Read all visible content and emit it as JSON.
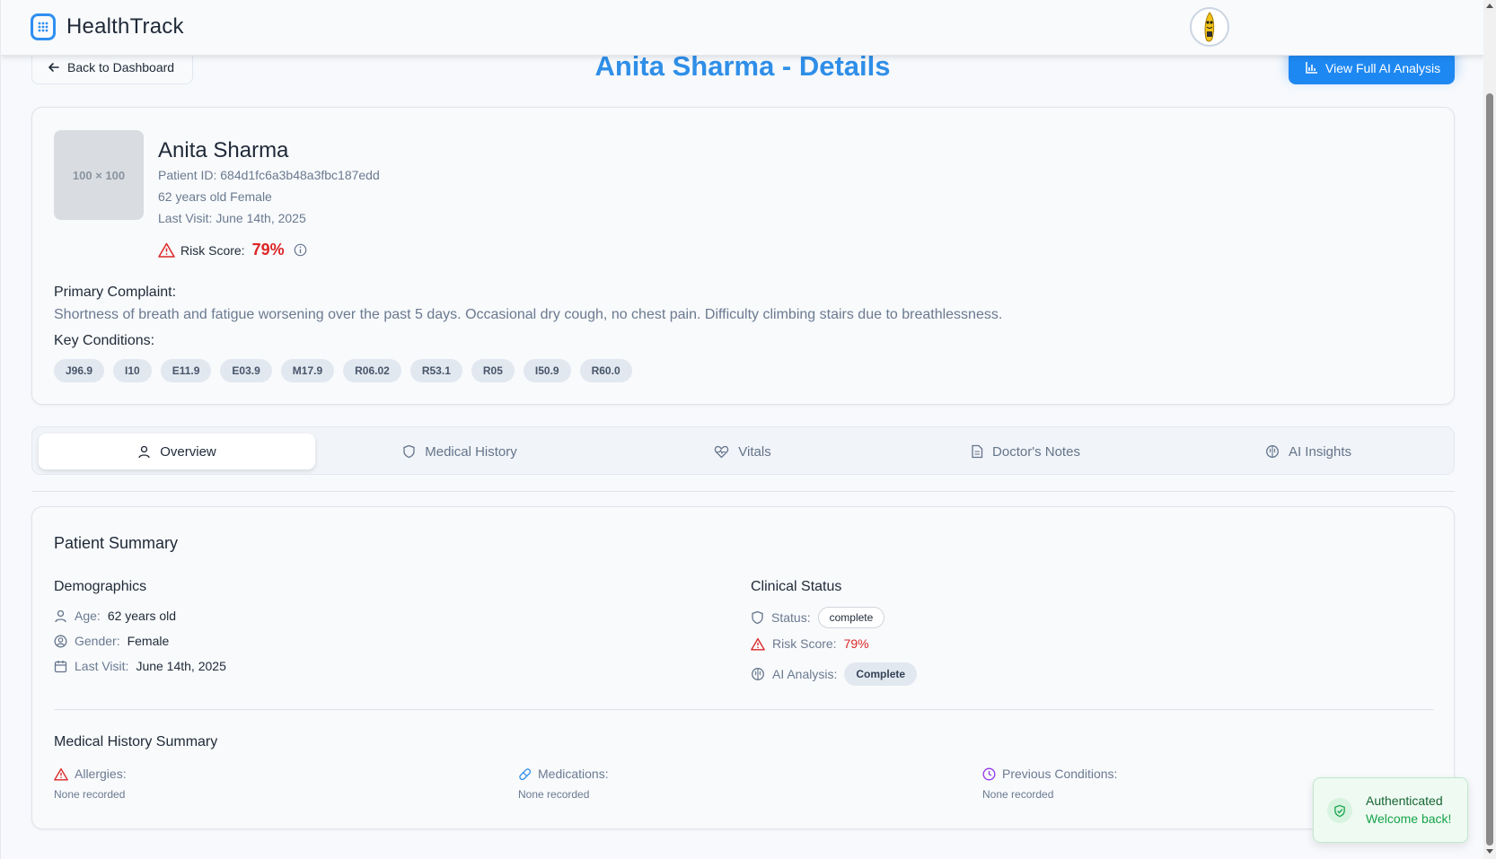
{
  "app": {
    "name": "HealthTrack"
  },
  "header": {
    "back_label": "Back to Dashboard",
    "title": "Anita Sharma - Details",
    "ai_button_label": "View Full AI Analysis"
  },
  "patient": {
    "photo_placeholder": "100 × 100",
    "name": "Anita Sharma",
    "id_line": "Patient ID: 684d1fc6a3b48a3fbc187edd",
    "age_gender": "62 years old Female",
    "last_visit": "Last Visit: June 14th, 2025",
    "risk_label": "Risk Score:",
    "risk_value": "79%",
    "complaint_label": "Primary Complaint:",
    "complaint": "Shortness of breath and fatigue worsening over the past 5 days. Occasional dry cough, no chest pain. Difficulty climbing stairs due to breathlessness.",
    "conditions_label": "Key Conditions:",
    "conditions": [
      "J96.9",
      "I10",
      "E11.9",
      "E03.9",
      "M17.9",
      "R06.02",
      "R53.1",
      "R05",
      "I50.9",
      "R60.0"
    ]
  },
  "tabs": [
    {
      "label": "Overview",
      "icon": "user-icon",
      "active": true
    },
    {
      "label": "Medical History",
      "icon": "shield-icon",
      "active": false
    },
    {
      "label": "Vitals",
      "icon": "heart-pulse-icon",
      "active": false
    },
    {
      "label": "Doctor's Notes",
      "icon": "document-icon",
      "active": false
    },
    {
      "label": "AI Insights",
      "icon": "brain-icon",
      "active": false
    }
  ],
  "summary": {
    "title": "Patient Summary",
    "demographics": {
      "heading": "Demographics",
      "age_label": "Age:",
      "age_value": "62 years old",
      "gender_label": "Gender:",
      "gender_value": "Female",
      "visit_label": "Last Visit:",
      "visit_value": "June 14th, 2025"
    },
    "clinical": {
      "heading": "Clinical Status",
      "status_label": "Status:",
      "status_value": "complete",
      "risk_label": "Risk Score:",
      "risk_value": "79%",
      "ai_label": "AI Analysis:",
      "ai_value": "Complete"
    },
    "history": {
      "heading": "Medical History Summary",
      "allergies_label": "Allergies:",
      "allergies_value": "None recorded",
      "medications_label": "Medications:",
      "medications_value": "None recorded",
      "conditions_label": "Previous Conditions:",
      "conditions_value": "None recorded"
    }
  },
  "toast": {
    "title": "Authenticated",
    "message": "Welcome back!"
  },
  "colors": {
    "accent": "#1e88f2",
    "title": "#2f8fe8",
    "danger": "#dc2626",
    "success": "#16a34a"
  }
}
